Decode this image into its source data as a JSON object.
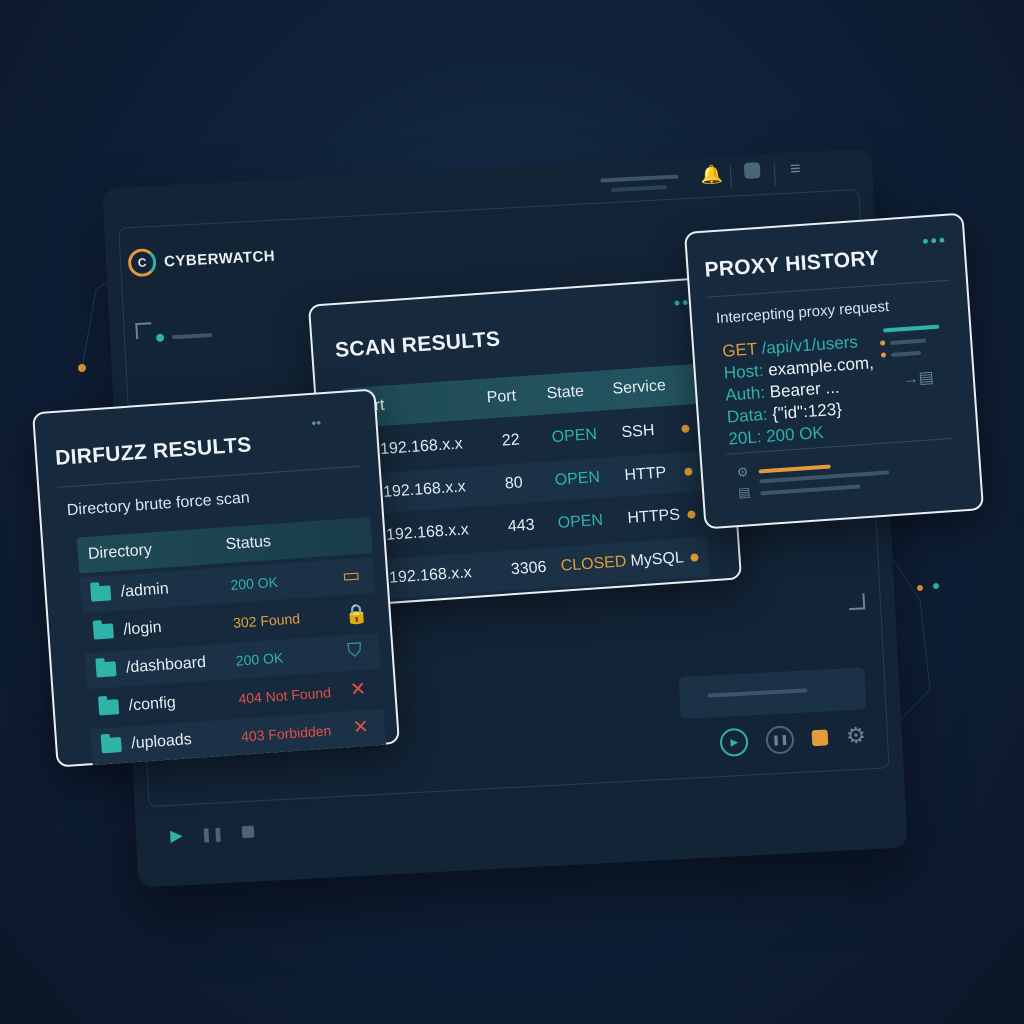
{
  "app": {
    "brand": "CYBERWATCH",
    "brand_logo": "C"
  },
  "dirfuzz": {
    "title": "DIRFUZZ RESULTS",
    "subtitle": "Directory brute force scan",
    "columns": [
      "Directory",
      "Status"
    ],
    "rows": [
      {
        "directory": "/admin",
        "status": "200 OK",
        "status_color": "#2fb3a8",
        "icon": "folder-outline-icon",
        "icon_glyph": "▭",
        "icon_color": "#e39a3a"
      },
      {
        "directory": "/login",
        "status": "302 Found",
        "status_color": "#e3a23a",
        "icon": "lock-icon",
        "icon_glyph": "🔒",
        "icon_color": "#e39a3a"
      },
      {
        "directory": "/dashboard",
        "status": "200 OK",
        "status_color": "#2fb3a8",
        "icon": "shield-icon",
        "icon_glyph": "⛉",
        "icon_color": "#2fb3a8"
      },
      {
        "directory": "/config",
        "status": "404 Not Found",
        "status_color": "#e2504a",
        "icon": "x-icon",
        "icon_glyph": "✕",
        "icon_color": "#e2504a"
      },
      {
        "directory": "/uploads",
        "status": "403 Forbidden",
        "status_color": "#e2504a",
        "icon": "x-icon",
        "icon_glyph": "✕",
        "icon_color": "#e2504a"
      }
    ]
  },
  "scan": {
    "title": "SCAN RESULTS",
    "columns": [
      "Port",
      "Port",
      "State",
      "Service"
    ],
    "rows": [
      {
        "ip": "192.168.x.x",
        "port": "22",
        "state": "OPEN",
        "state_color": "#2fb3a8",
        "service": "SSH"
      },
      {
        "ip": "192.168.x.x",
        "port": "80",
        "state": "OPEN",
        "state_color": "#2fb3a8",
        "service": "HTTP"
      },
      {
        "ip": "192.168.x.x",
        "port": "443",
        "state": "OPEN",
        "state_color": "#2fb3a8",
        "service": "HTTPS"
      },
      {
        "ip": "192.168.x.x",
        "port": "3306",
        "state": "CLOSED",
        "state_color": "#e39a3a",
        "service": "MySQL"
      }
    ]
  },
  "proxy": {
    "title": "PROXY HISTORY",
    "subtitle": "Intercepting proxy request",
    "lines": [
      {
        "key": "GET",
        "value": " /api/v1/users",
        "key_color": "#e39a3a",
        "value_color": "#2fb3a8"
      },
      {
        "key": "Host:",
        "value": " example.com,",
        "key_color": "#2fb3a8",
        "value_color": "#eef3f7"
      },
      {
        "key": "Auth:",
        "value": " Bearer ...",
        "key_color": "#2fb3a8",
        "value_color": "#eef3f7"
      },
      {
        "key": "Data:",
        "value": " {\"id\":123}",
        "key_color": "#2fb3a8",
        "value_color": "#eef3f7"
      },
      {
        "key": "20L:",
        "value": " 200 OK",
        "key_color": "#2fb3a8",
        "value_color": "#2fb3a8"
      }
    ]
  },
  "colors": {
    "accent": "#2fb3a8",
    "warning": "#e39a3a",
    "danger": "#e2504a"
  }
}
